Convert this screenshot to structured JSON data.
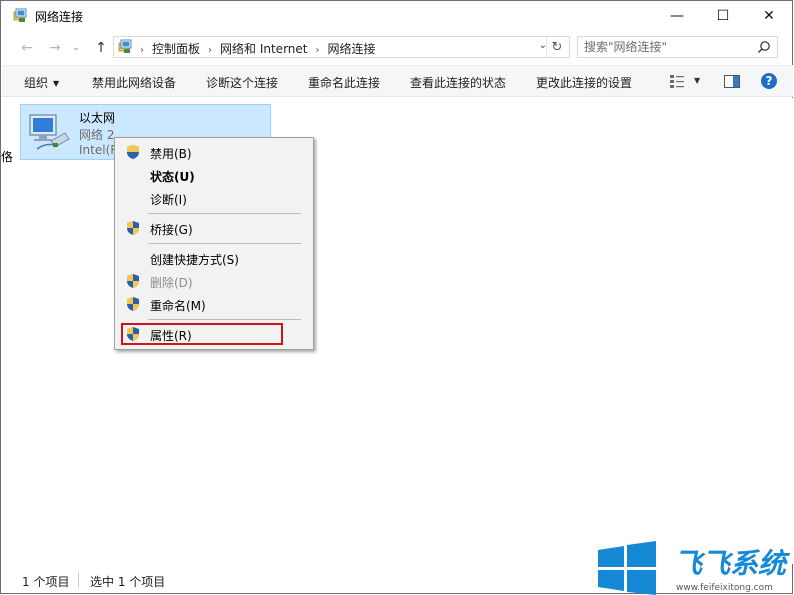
{
  "window": {
    "title": "网络连接",
    "controls": {
      "minimize": "—",
      "maximize": "☐",
      "close": "✕"
    }
  },
  "navigation": {
    "back": "←",
    "forward": "→",
    "recent": "⌄",
    "up": "↑"
  },
  "address": {
    "crumbs": [
      "控制面板",
      "网络和 Internet",
      "网络连接"
    ],
    "separator": "›",
    "dropdown": "⌄",
    "refresh": "↻"
  },
  "search": {
    "placeholder": "搜索\"网络连接\""
  },
  "toolbar": {
    "organize": "组织",
    "disable": "禁用此网络设备",
    "diagnose": "诊断这个连接",
    "rename": "重命名此连接",
    "view_status": "查看此连接的状态",
    "change_settings": "更改此连接的设置",
    "help": "?"
  },
  "connection": {
    "name": "以太网",
    "network": "网络 2",
    "device": "Intel(R"
  },
  "left_clip_text": "佫",
  "context_menu": {
    "items": [
      {
        "label": "禁用(B)",
        "shield": true,
        "bold": false,
        "disabled": false
      },
      {
        "label": "状态(U)",
        "shield": false,
        "bold": true,
        "disabled": false
      },
      {
        "label": "诊断(I)",
        "shield": false,
        "bold": false,
        "disabled": false
      },
      {
        "label": "桥接(G)",
        "shield": true,
        "bold": false,
        "disabled": false
      },
      {
        "label": "创建快捷方式(S)",
        "shield": false,
        "bold": false,
        "disabled": false
      },
      {
        "label": "删除(D)",
        "shield": true,
        "bold": false,
        "disabled": true
      },
      {
        "label": "重命名(M)",
        "shield": true,
        "bold": false,
        "disabled": false
      },
      {
        "label": "属性(R)",
        "shield": true,
        "bold": false,
        "disabled": false,
        "highlighted": true
      }
    ],
    "highlight_color": "#d0141b"
  },
  "statusbar": {
    "count": "1 个项目",
    "selected": "选中 1 个项目"
  },
  "watermark": {
    "text": "飞飞系统",
    "url": "www.feifeixitong.com"
  },
  "colors": {
    "selection_bg": "#cce8ff",
    "selection_border": "#99d1ff",
    "toolbar_bg": "#f5f6f7",
    "menu_bg": "#f2f2f2",
    "help_blue": "#1f6fc6",
    "watermark_blue": "#1589d6"
  }
}
